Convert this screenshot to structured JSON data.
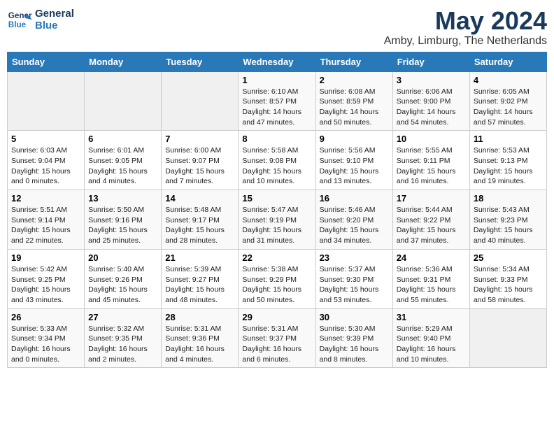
{
  "logo": {
    "line1": "General",
    "line2": "Blue"
  },
  "title": "May 2024",
  "subtitle": "Amby, Limburg, The Netherlands",
  "days_of_week": [
    "Sunday",
    "Monday",
    "Tuesday",
    "Wednesday",
    "Thursday",
    "Friday",
    "Saturday"
  ],
  "weeks": [
    [
      {
        "day": "",
        "info": ""
      },
      {
        "day": "",
        "info": ""
      },
      {
        "day": "",
        "info": ""
      },
      {
        "day": "1",
        "info": "Sunrise: 6:10 AM\nSunset: 8:57 PM\nDaylight: 14 hours\nand 47 minutes."
      },
      {
        "day": "2",
        "info": "Sunrise: 6:08 AM\nSunset: 8:59 PM\nDaylight: 14 hours\nand 50 minutes."
      },
      {
        "day": "3",
        "info": "Sunrise: 6:06 AM\nSunset: 9:00 PM\nDaylight: 14 hours\nand 54 minutes."
      },
      {
        "day": "4",
        "info": "Sunrise: 6:05 AM\nSunset: 9:02 PM\nDaylight: 14 hours\nand 57 minutes."
      }
    ],
    [
      {
        "day": "5",
        "info": "Sunrise: 6:03 AM\nSunset: 9:04 PM\nDaylight: 15 hours\nand 0 minutes."
      },
      {
        "day": "6",
        "info": "Sunrise: 6:01 AM\nSunset: 9:05 PM\nDaylight: 15 hours\nand 4 minutes."
      },
      {
        "day": "7",
        "info": "Sunrise: 6:00 AM\nSunset: 9:07 PM\nDaylight: 15 hours\nand 7 minutes."
      },
      {
        "day": "8",
        "info": "Sunrise: 5:58 AM\nSunset: 9:08 PM\nDaylight: 15 hours\nand 10 minutes."
      },
      {
        "day": "9",
        "info": "Sunrise: 5:56 AM\nSunset: 9:10 PM\nDaylight: 15 hours\nand 13 minutes."
      },
      {
        "day": "10",
        "info": "Sunrise: 5:55 AM\nSunset: 9:11 PM\nDaylight: 15 hours\nand 16 minutes."
      },
      {
        "day": "11",
        "info": "Sunrise: 5:53 AM\nSunset: 9:13 PM\nDaylight: 15 hours\nand 19 minutes."
      }
    ],
    [
      {
        "day": "12",
        "info": "Sunrise: 5:51 AM\nSunset: 9:14 PM\nDaylight: 15 hours\nand 22 minutes."
      },
      {
        "day": "13",
        "info": "Sunrise: 5:50 AM\nSunset: 9:16 PM\nDaylight: 15 hours\nand 25 minutes."
      },
      {
        "day": "14",
        "info": "Sunrise: 5:48 AM\nSunset: 9:17 PM\nDaylight: 15 hours\nand 28 minutes."
      },
      {
        "day": "15",
        "info": "Sunrise: 5:47 AM\nSunset: 9:19 PM\nDaylight: 15 hours\nand 31 minutes."
      },
      {
        "day": "16",
        "info": "Sunrise: 5:46 AM\nSunset: 9:20 PM\nDaylight: 15 hours\nand 34 minutes."
      },
      {
        "day": "17",
        "info": "Sunrise: 5:44 AM\nSunset: 9:22 PM\nDaylight: 15 hours\nand 37 minutes."
      },
      {
        "day": "18",
        "info": "Sunrise: 5:43 AM\nSunset: 9:23 PM\nDaylight: 15 hours\nand 40 minutes."
      }
    ],
    [
      {
        "day": "19",
        "info": "Sunrise: 5:42 AM\nSunset: 9:25 PM\nDaylight: 15 hours\nand 43 minutes."
      },
      {
        "day": "20",
        "info": "Sunrise: 5:40 AM\nSunset: 9:26 PM\nDaylight: 15 hours\nand 45 minutes."
      },
      {
        "day": "21",
        "info": "Sunrise: 5:39 AM\nSunset: 9:27 PM\nDaylight: 15 hours\nand 48 minutes."
      },
      {
        "day": "22",
        "info": "Sunrise: 5:38 AM\nSunset: 9:29 PM\nDaylight: 15 hours\nand 50 minutes."
      },
      {
        "day": "23",
        "info": "Sunrise: 5:37 AM\nSunset: 9:30 PM\nDaylight: 15 hours\nand 53 minutes."
      },
      {
        "day": "24",
        "info": "Sunrise: 5:36 AM\nSunset: 9:31 PM\nDaylight: 15 hours\nand 55 minutes."
      },
      {
        "day": "25",
        "info": "Sunrise: 5:34 AM\nSunset: 9:33 PM\nDaylight: 15 hours\nand 58 minutes."
      }
    ],
    [
      {
        "day": "26",
        "info": "Sunrise: 5:33 AM\nSunset: 9:34 PM\nDaylight: 16 hours\nand 0 minutes."
      },
      {
        "day": "27",
        "info": "Sunrise: 5:32 AM\nSunset: 9:35 PM\nDaylight: 16 hours\nand 2 minutes."
      },
      {
        "day": "28",
        "info": "Sunrise: 5:31 AM\nSunset: 9:36 PM\nDaylight: 16 hours\nand 4 minutes."
      },
      {
        "day": "29",
        "info": "Sunrise: 5:31 AM\nSunset: 9:37 PM\nDaylight: 16 hours\nand 6 minutes."
      },
      {
        "day": "30",
        "info": "Sunrise: 5:30 AM\nSunset: 9:39 PM\nDaylight: 16 hours\nand 8 minutes."
      },
      {
        "day": "31",
        "info": "Sunrise: 5:29 AM\nSunset: 9:40 PM\nDaylight: 16 hours\nand 10 minutes."
      },
      {
        "day": "",
        "info": ""
      }
    ]
  ]
}
